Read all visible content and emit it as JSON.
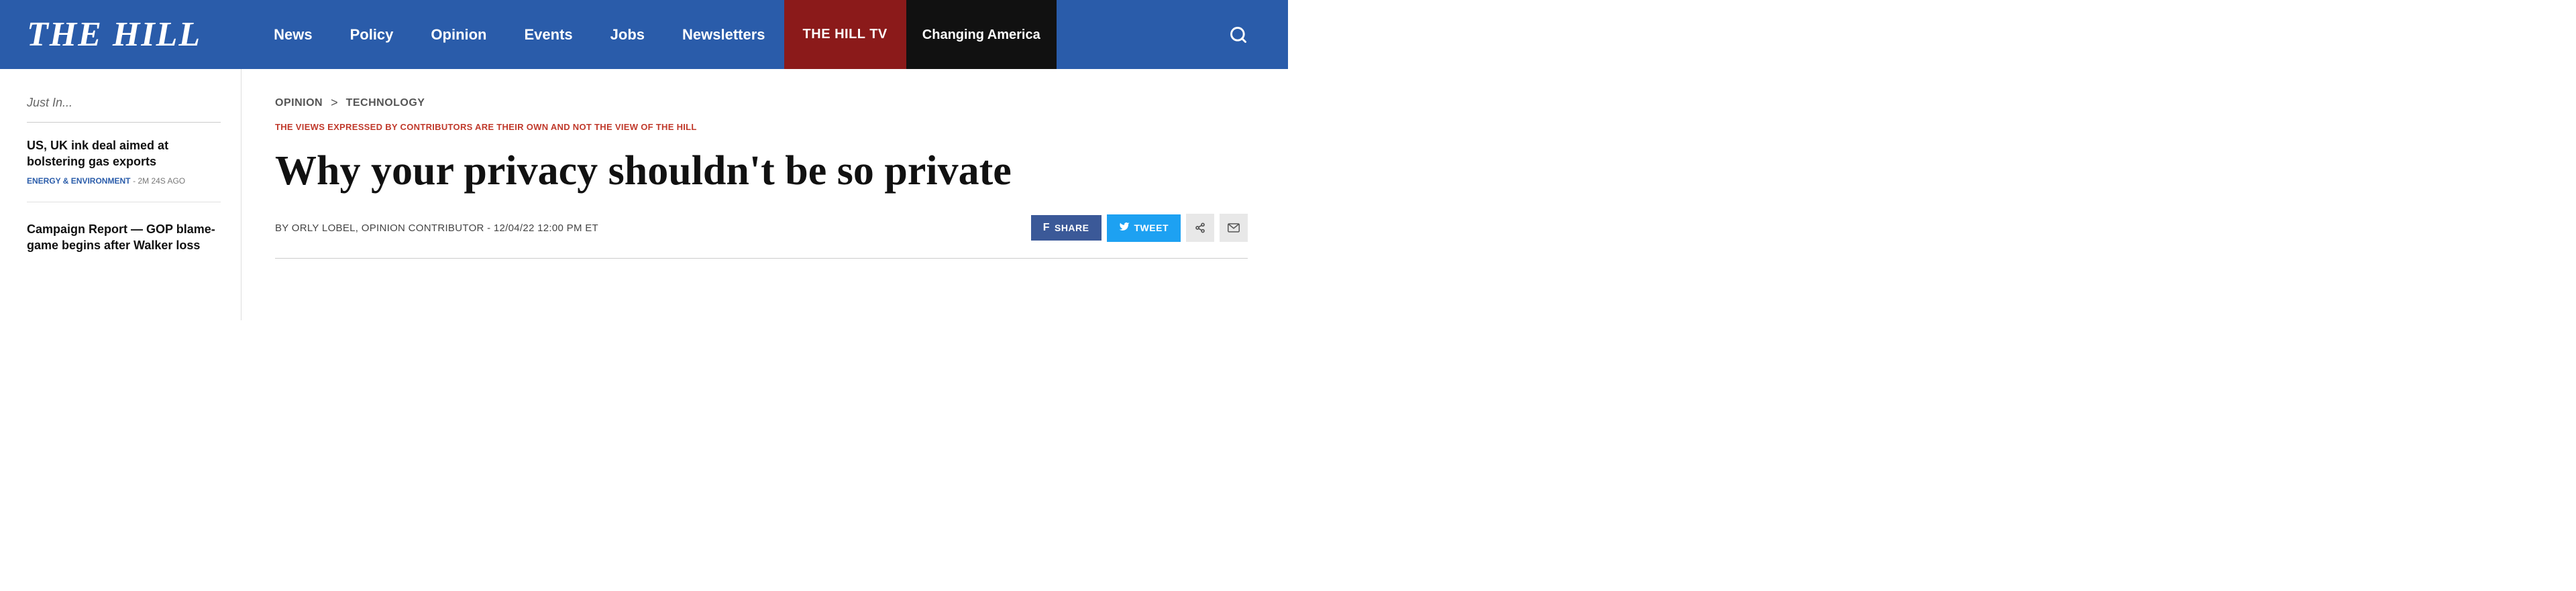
{
  "site": {
    "logo": "THE HILL"
  },
  "header": {
    "nav_items": [
      {
        "label": "News",
        "id": "news",
        "style": "default"
      },
      {
        "label": "Policy",
        "id": "policy",
        "style": "default"
      },
      {
        "label": "Opinion",
        "id": "opinion",
        "style": "default"
      },
      {
        "label": "Events",
        "id": "events",
        "style": "default"
      },
      {
        "label": "Jobs",
        "id": "jobs",
        "style": "default"
      },
      {
        "label": "Newsletters",
        "id": "newsletters",
        "style": "default"
      },
      {
        "label": "THE HILL TV",
        "id": "hill-tv",
        "style": "hill-tv"
      },
      {
        "label": "Changing America",
        "id": "changing-america",
        "style": "changing-america"
      }
    ]
  },
  "sidebar": {
    "just_in_label": "Just In...",
    "articles": [
      {
        "title": "US, UK ink deal aimed at bolstering gas exports",
        "category": "ENERGY & ENVIRONMENT",
        "time": "2M 24S AGO"
      },
      {
        "title": "Campaign Report — GOP blame-game begins after Walker loss",
        "category": "",
        "time": ""
      }
    ]
  },
  "article": {
    "breadcrumb_section": "OPINION",
    "breadcrumb_separator": ">",
    "breadcrumb_category": "TECHNOLOGY",
    "disclaimer": "THE VIEWS EXPRESSED BY CONTRIBUTORS ARE THEIR OWN AND NOT THE VIEW OF THE HILL",
    "title": "Why your privacy shouldn't be so private",
    "byline": "BY ORLY LOBEL, OPINION CONTRIBUTOR - 12/04/22 12:00 PM ET",
    "social": {
      "facebook_label": "SHARE",
      "twitter_label": "TWEET",
      "facebook_icon": "f",
      "twitter_icon": "t"
    }
  }
}
